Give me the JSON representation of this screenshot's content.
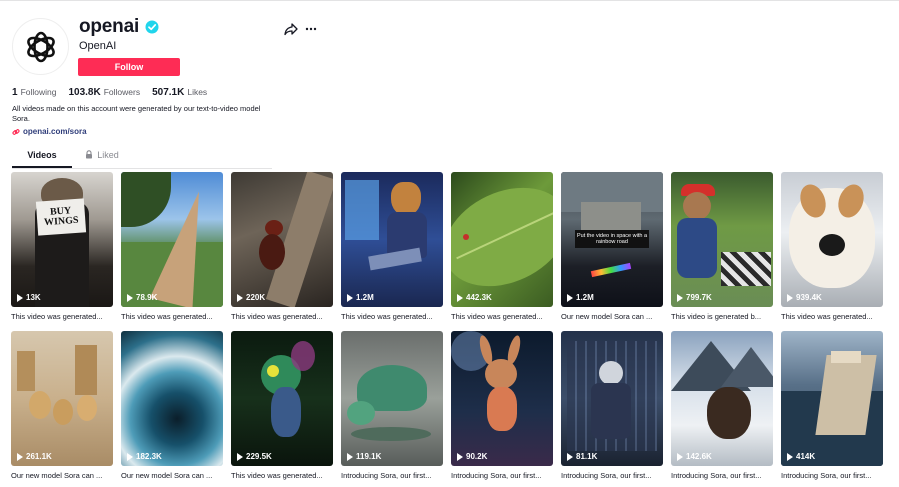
{
  "profile": {
    "username": "openai",
    "nickname": "OpenAI",
    "follow_label": "Follow",
    "verified_icon": "verified-badge-icon",
    "avatar_icon": "openai-logo",
    "share_icon": "share-arrow-icon",
    "more_icon": "more-dots-icon"
  },
  "stats": {
    "following_count": "1",
    "following_label": "Following",
    "followers_count": "103.8K",
    "followers_label": "Followers",
    "likes_count": "507.1K",
    "likes_label": "Likes"
  },
  "bio": {
    "text": "All videos made on this account were generated by our text-to-video model Sora.",
    "link_icon": "link-icon",
    "link_text": "openai.com/sora"
  },
  "tabs": {
    "videos_label": "Videos",
    "liked_label": "Liked",
    "liked_icon": "lock-icon"
  },
  "colors": {
    "follow_button": "#fe2c55",
    "verified": "#20d5ec",
    "link": "#2f3d7a"
  },
  "videos": [
    {
      "views": "13K",
      "caption": "This video was generated...",
      "overlay": "BUY WINGS"
    },
    {
      "views": "78.9K",
      "caption": "This video was generated..."
    },
    {
      "views": "220K",
      "caption": "This video was generated..."
    },
    {
      "views": "1.2M",
      "caption": "This video was generated..."
    },
    {
      "views": "442.3K",
      "caption": "This video was generated..."
    },
    {
      "views": "1.2M",
      "caption": "Our new model Sora can ...",
      "overlay": "Put the video in space with a rainbow road"
    },
    {
      "views": "799.7K",
      "caption": "This video is generated b..."
    },
    {
      "views": "939.4K",
      "caption": "This video was generated..."
    },
    {
      "views": "261.1K",
      "caption": "Our new model Sora can ..."
    },
    {
      "views": "182.3K",
      "caption": "Our new model Sora can ..."
    },
    {
      "views": "229.5K",
      "caption": "This video was generated..."
    },
    {
      "views": "119.1K",
      "caption": "Introducing Sora, our first..."
    },
    {
      "views": "90.2K",
      "caption": "Introducing Sora, our first..."
    },
    {
      "views": "81.1K",
      "caption": "Introducing Sora, our first..."
    },
    {
      "views": "142.6K",
      "caption": "Introducing Sora, our first..."
    },
    {
      "views": "414K",
      "caption": "Introducing Sora, our first..."
    }
  ]
}
